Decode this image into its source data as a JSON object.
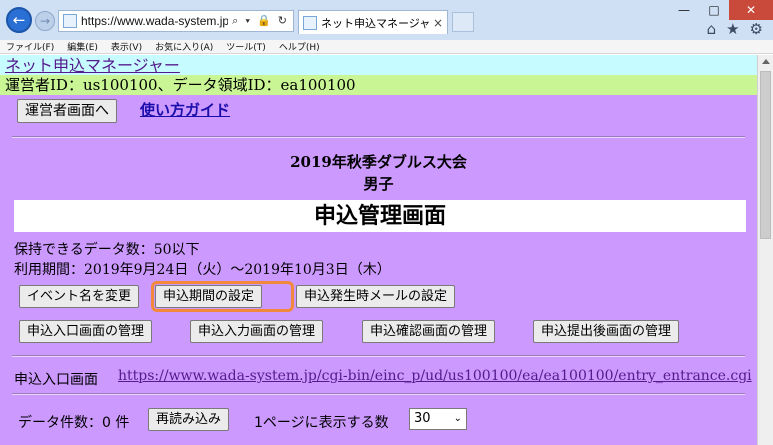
{
  "browser": {
    "url": "https://www.wada-system.jp/cgi-bin/einc_",
    "address_tools": "⌕ ▾ 🔒 ↻",
    "tab_title": "ネット申込マネージャー 申込...",
    "menu": [
      "ファイル(F)",
      "編集(E)",
      "表示(V)",
      "お気に入り(A)",
      "ツール(T)",
      "ヘルプ(H)"
    ]
  },
  "header": {
    "app_link": "ネット申込マネージャー",
    "info": "運営者ID：us100100、データ領域ID：ea100100"
  },
  "toolbar": {
    "admin_button": "運営者画面へ",
    "guide_link": "使い方ガイド"
  },
  "event": {
    "title": "2019年秋季ダブルス大会",
    "subtitle": "男子",
    "screen_title": "申込管理画面"
  },
  "limits": {
    "storage": "保持できるデータ数：50以下",
    "period": "利用期間：2019年9月24日（火）〜2019年10月3日（木）"
  },
  "buttons": {
    "rename_event": "イベント名を変更",
    "set_period": "申込期間の設定",
    "mail_settings": "申込発生時メールの設定",
    "entrance_screen": "申込入口画面の管理",
    "input_screen": "申込入力画面の管理",
    "confirm_screen": "申込確認画面の管理",
    "after_submit_screen": "申込提出後画面の管理",
    "reload": "再読み込み"
  },
  "entrance": {
    "label": "申込入口画面",
    "url": "https://www.wada-system.jp/cgi-bin/einc_p/ud/us100100/ea/ea100100/entry_entrance.cgi"
  },
  "data_list": {
    "count_label": "データ件数：0 件",
    "per_page_label": "1ページに表示する数",
    "per_page_value": "30"
  },
  "colors": {
    "page_bg": "#cc99ff",
    "banner_bg": "#c6fbff",
    "info_bg": "#c9f594",
    "highlight": "#f1883a"
  }
}
